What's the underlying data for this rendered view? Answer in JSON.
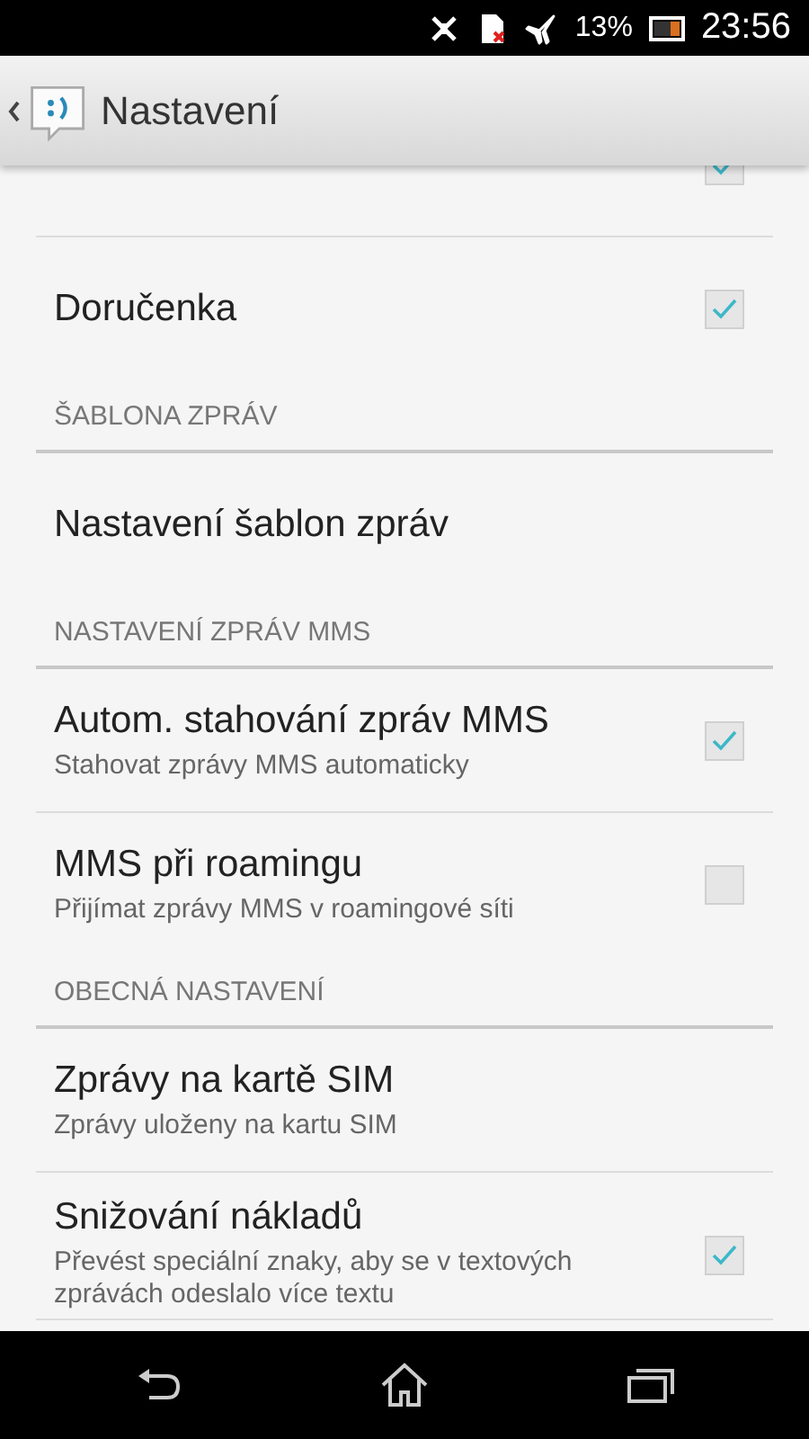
{
  "status_bar": {
    "battery_text": "13%",
    "time": "23:56"
  },
  "header": {
    "title": "Nastavení"
  },
  "items": [
    {
      "kind": "checkbox",
      "checked": true
    },
    {
      "kind": "checkbox",
      "title": "Doručenka",
      "checked": true
    },
    {
      "kind": "section",
      "title": "ŠABLONA ZPRÁV"
    },
    {
      "kind": "plain",
      "title": "Nastavení šablon zpráv"
    },
    {
      "kind": "section",
      "title": "NASTAVENÍ ZPRÁV MMS"
    },
    {
      "kind": "checkbox",
      "title": "Autom. stahování zpráv MMS",
      "subtitle": "Stahovat zprávy MMS automaticky",
      "checked": true
    },
    {
      "kind": "checkbox",
      "title": "MMS při roamingu",
      "subtitle": "Přijímat zprávy MMS v roamingové síti",
      "checked": false
    },
    {
      "kind": "section",
      "title": "OBECNÁ NASTAVENÍ"
    },
    {
      "kind": "plain",
      "title": "Zprávy na kartě SIM",
      "subtitle": "Zprávy uloženy na kartu SIM"
    },
    {
      "kind": "checkbox",
      "title": "Snižování nákladů",
      "subtitle": "Převést speciální znaky, aby se v textových zprávách odeslalo více textu",
      "checked": true
    }
  ]
}
